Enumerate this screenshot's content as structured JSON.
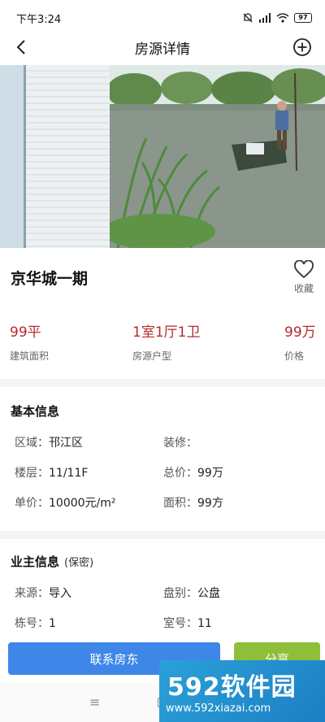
{
  "status_bar": {
    "time": "下午3:24",
    "battery": "97"
  },
  "header": {
    "title": "房源详情",
    "back_icon": "back-arrow-icon",
    "add_icon": "plus-circle-icon"
  },
  "house": {
    "title": "京华城一期",
    "favorite_label": "收藏"
  },
  "stats": [
    {
      "value": "99平",
      "label": "建筑面积"
    },
    {
      "value": "1室1厅1卫",
      "label": "房源户型"
    },
    {
      "value": "99万",
      "label": "价格"
    }
  ],
  "basic": {
    "title": "基本信息",
    "items": [
      {
        "key": "区域：",
        "value": "邗江区"
      },
      {
        "key": "装修：",
        "value": ""
      },
      {
        "key": "楼层：",
        "value": "11/11F"
      },
      {
        "key": "总价：",
        "value": "99万"
      },
      {
        "key": "单价：",
        "value": "10000元/m²"
      },
      {
        "key": "面积：",
        "value": "99方"
      }
    ]
  },
  "owner": {
    "title": "业主信息",
    "subtitle": "(保密)",
    "items": [
      {
        "key": "来源：",
        "value": "导入"
      },
      {
        "key": "盘别：",
        "value": "公盘"
      },
      {
        "key": "栋号：",
        "value": "1"
      },
      {
        "key": "室号：",
        "value": "11"
      }
    ]
  },
  "actions": {
    "contact": "联系房东",
    "share": "分享"
  },
  "system_nav": {
    "menu_glyph": "≡"
  },
  "watermark": {
    "brand": "592软件园",
    "url": "www.592xiazai.com"
  },
  "colors": {
    "accent_red": "#b52a2a",
    "contact_blue": "#3e86e8",
    "share_green": "#8fbf3a"
  }
}
